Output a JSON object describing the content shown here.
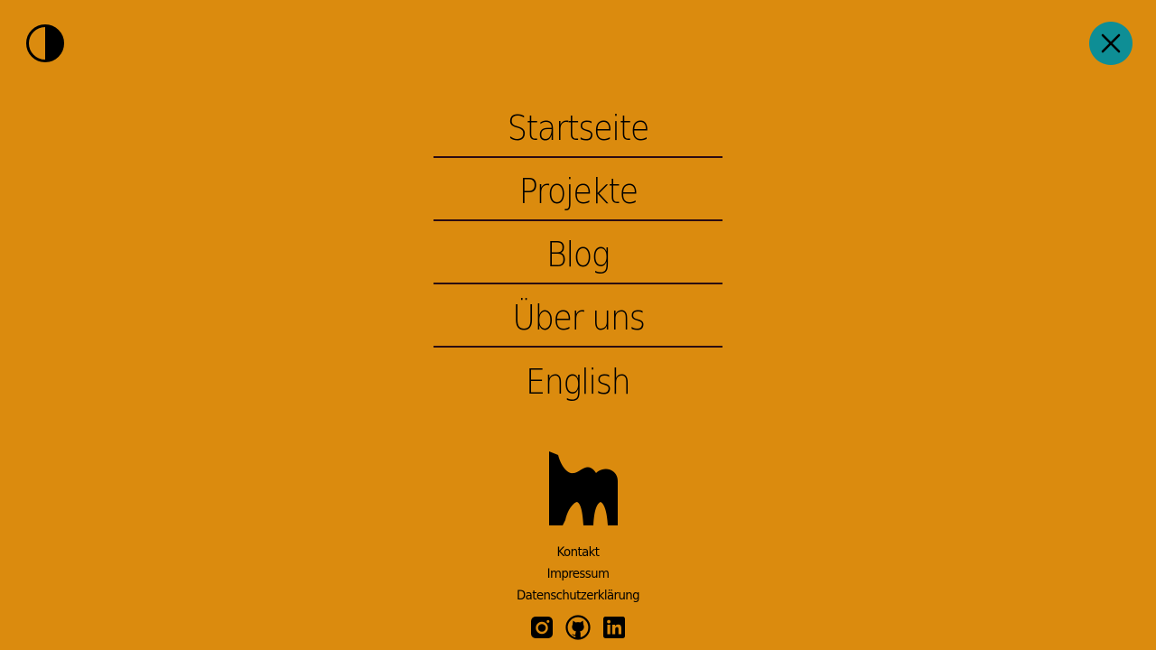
{
  "header": {
    "contrast_toggle_icon": "half-circle-contrast-icon",
    "close_icon": "close-x-icon",
    "close_button_color": "#0E8E95"
  },
  "theme": {
    "background": "#DB8B0E",
    "divider": "#2A0A12",
    "text": "#000000"
  },
  "nav": {
    "items": [
      {
        "label": "Startseite"
      },
      {
        "label": "Projekte"
      },
      {
        "label": "Blog"
      },
      {
        "label": "Über uns"
      },
      {
        "label": "English"
      }
    ]
  },
  "footer": {
    "logo_icon": "brand-logo-icon",
    "links": [
      {
        "label": "Kontakt"
      },
      {
        "label": "Impressum"
      },
      {
        "label": "Datenschutzerklärung"
      }
    ],
    "social": [
      {
        "icon": "instagram-icon"
      },
      {
        "icon": "github-icon"
      },
      {
        "icon": "linkedin-icon"
      }
    ]
  }
}
